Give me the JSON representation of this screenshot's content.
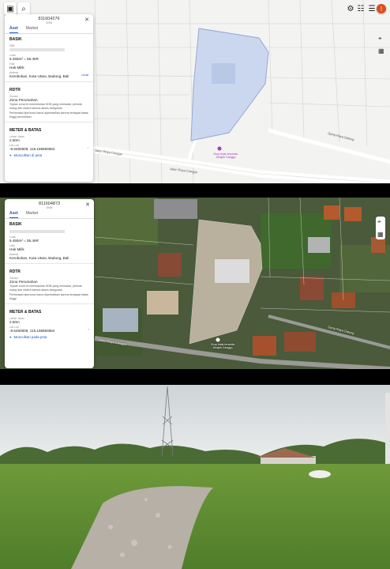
{
  "panel1": {
    "parcel_id": "811604276",
    "parcel_sub": "SHM",
    "tabs": [
      "Aset",
      "Market"
    ],
    "section_basic": "BASIK",
    "nib_label": "NIB",
    "luas_label": "Luas",
    "luas_value": "5.455m² = 55.46R",
    "hak_label": "Hak",
    "hak_value": "Hak Milik",
    "alamat_label": "Alamat",
    "alamat_value": "Kerobokan, Kuta Utara, Badung, Bali",
    "alamat_link": "Lihat",
    "section_rdtr": "RDTR",
    "zona_label": "Zonasi",
    "zona_value": "Zona Perumahan",
    "zona_desc": "Tujuan zona ini menentukan KDB yang memadai, periode ruang dan sistem semua akses bangunan",
    "zona_note": "Perbedaan tipe/zona harus diperhatikan karena terdapat batas tinggi peruntukan",
    "section_meter": "METER & BATAS",
    "lebar_label": "Lebar Jalan",
    "lebar_value": "2.50m",
    "latlon_label": "Lat Lon",
    "latlon_value": "-8.6450609, 115.166883562",
    "foot_link": "Munculkan di peta"
  },
  "panel2": {
    "parcel_id": "811604873",
    "parcel_sub": "SHM",
    "tabs": [
      "Aset",
      "Market"
    ],
    "section_basic": "BASIK",
    "luas_label": "Luas",
    "luas_value": "5.455m² = 55.46R",
    "hak_label": "Hak",
    "hak_value": "Hak Milik",
    "alamat_label": "Alamat",
    "alamat_value": "Kerobokan, Kuta Utara, Badung, Bali",
    "section_rdtr": "RDTR",
    "zona_label": "Zonasi",
    "zona_value": "Zona Perumahan",
    "zona_desc": "Tujuan zona ini menentukan KDB yang memadai, periode ruang dan sistem semua akses bangunan",
    "zona_note": "Perbedaan tipe/zona harus diperhatikan karena terdapat batas tinggi",
    "section_meter": "METER & BATAS",
    "lebar_label": "Lebar Jalan",
    "lebar_value": "2.50m",
    "latlon_label": "Lat Lon",
    "latlon_value": "-8.6450609, 115.166883562",
    "foot_link": "Munculkan pada peta"
  },
  "map": {
    "road_main": "Jalan Raya Canggu",
    "road_main2": "Jalan Raya Canggu",
    "road_side": "Gang Raya Dalung",
    "road_left": "Jalan Raya Canggu",
    "marker_label": "Grup tidak tersedia, Jelajah Canggu"
  },
  "sat": {
    "road_left": "Jalan Raya Canggu",
    "road_right": "Gang Raya Dalung",
    "marker_label": "Grup tidak tersedia Jelajah Canggu"
  },
  "colors": {
    "accent": "#1a56c4",
    "parcel_fill": "#c9d6ee",
    "parcel_stroke": "#8ea6d6"
  }
}
